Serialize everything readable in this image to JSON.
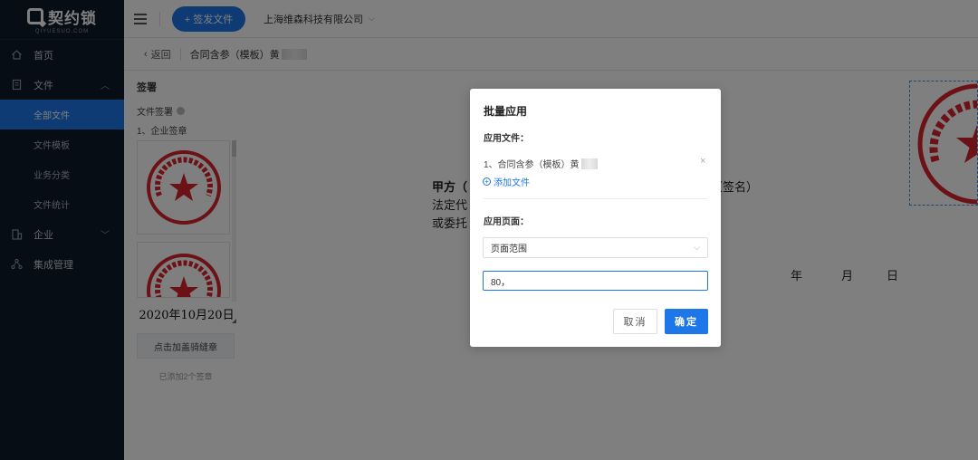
{
  "sidebar": {
    "logo_text": "契约锁",
    "logo_sub": "QIYUESUO.COM",
    "items": [
      {
        "label": "首页",
        "icon": "home-icon"
      },
      {
        "label": "文件",
        "icon": "file-icon"
      },
      {
        "label": "企业",
        "icon": "building-icon"
      },
      {
        "label": "集成管理",
        "icon": "integration-icon"
      }
    ],
    "sub_items": [
      {
        "label": "全部文件"
      },
      {
        "label": "文件模板"
      },
      {
        "label": "业务分类"
      },
      {
        "label": "文件统计"
      }
    ]
  },
  "topbar": {
    "send_button": "+ 签发文件",
    "company": "上海维森科技有限公司"
  },
  "crumbbar": {
    "back": "返回",
    "doc_title": "合同含参（模板）黄"
  },
  "left_panel": {
    "title": "签署",
    "section": "文件签署",
    "item": "1、企业签章",
    "date": "2020年10月20日",
    "add_stamp": "点击加盖骑缝章",
    "added_count": "已添加2个签章"
  },
  "document": {
    "party_a": "甲方（",
    "legal_rep": "法定代",
    "entrusted": "或委托",
    "sign": "（签名）",
    "year": "年",
    "month": "月",
    "day": "日"
  },
  "modal": {
    "title": "批量应用",
    "files_label": "应用文件：",
    "file_item": "1、合同含参（模板）黄",
    "add_file": "添加文件",
    "pages_label": "应用页面：",
    "page_range": "页面范围",
    "page_input": "80，",
    "cancel": "取消",
    "confirm": "确定"
  },
  "colors": {
    "sidebar_bg": "#0c1a2a",
    "accent": "#1d77e8",
    "seal_red": "#d9252c"
  }
}
